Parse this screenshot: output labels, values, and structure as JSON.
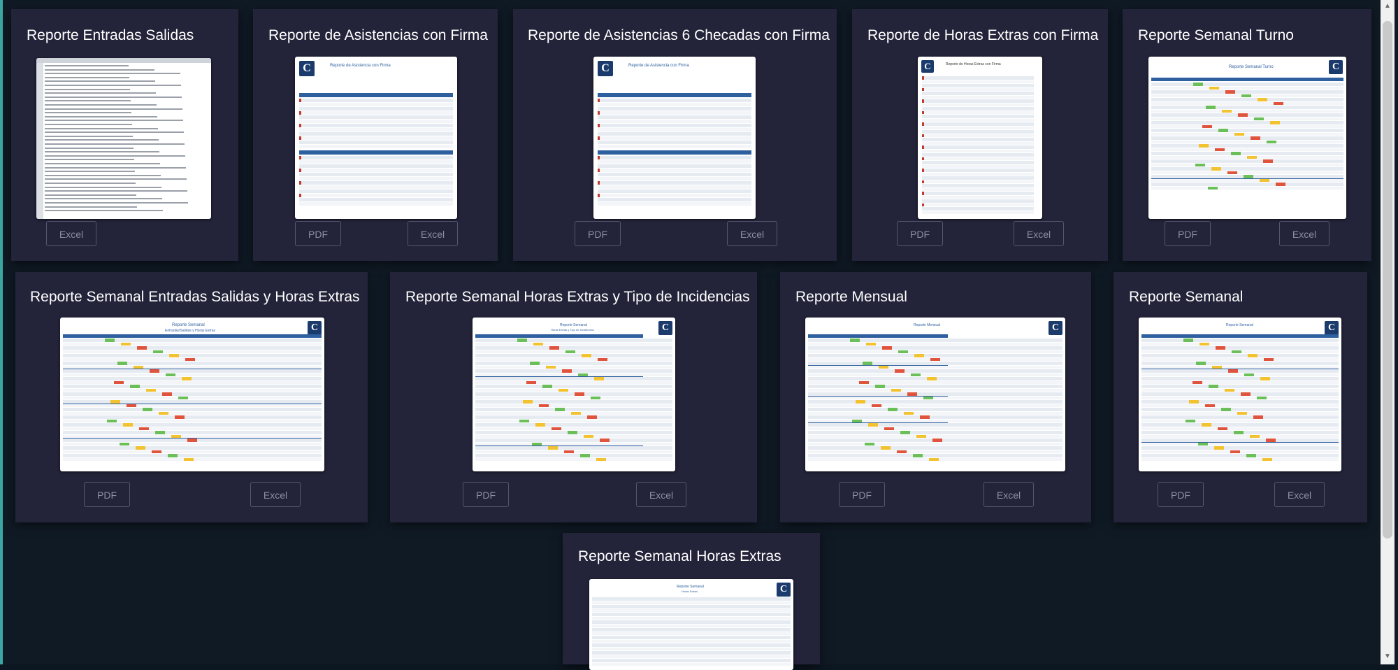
{
  "cards": [
    {
      "title": "Reporte Entradas Salidas",
      "buttons": [
        "Excel"
      ]
    },
    {
      "title": "Reporte de Asistencias con Firma",
      "buttons": [
        "PDF",
        "Excel"
      ]
    },
    {
      "title": "Reporte de Asistencias 6 Checadas con Firma",
      "buttons": [
        "PDF",
        "Excel"
      ]
    },
    {
      "title": "Reporte de Horas Extras con Firma",
      "buttons": [
        "PDF",
        "Excel"
      ]
    },
    {
      "title": "Reporte Semanal Turno",
      "buttons": [
        "PDF",
        "Excel"
      ]
    },
    {
      "title": "Reporte Semanal Entradas Salidas y Horas Extras",
      "buttons": [
        "PDF",
        "Excel"
      ]
    },
    {
      "title": "Reporte Semanal Horas Extras y Tipo de Incidencias",
      "buttons": [
        "PDF",
        "Excel"
      ]
    },
    {
      "title": "Reporte Mensual",
      "buttons": [
        "PDF",
        "Excel"
      ]
    },
    {
      "title": "Reporte Semanal",
      "buttons": [
        "PDF",
        "Excel"
      ]
    },
    {
      "title": "Reporte Semanal Horas Extras",
      "buttons": []
    }
  ],
  "thumb_titles": {
    "asistencia": "Reporte de Asistencia con Firma",
    "horas": "Reporte de Horas Extras con Firma",
    "turno": "Reporte Semanal Turno",
    "semanal_es": "Reporte Semanal",
    "semanal_es_sub": "Entradas/Salidas y Horas Extras",
    "semanal_hi": "Reporte Semanal",
    "semanal_hi_sub": "Horas Extras y Tipo de Incidencias",
    "mensual": "Reporte Mensual",
    "semanal": "Reporte Semanal",
    "semanal_he": "Reporte Semanal",
    "semanal_he_sub": "Horas Extras"
  },
  "logo_letter": "C",
  "colors": {
    "background": "#101a25",
    "card": "#23233a",
    "button_border": "#555770",
    "button_text": "#8d8ea3",
    "header_blue": "#2e5f9e"
  }
}
